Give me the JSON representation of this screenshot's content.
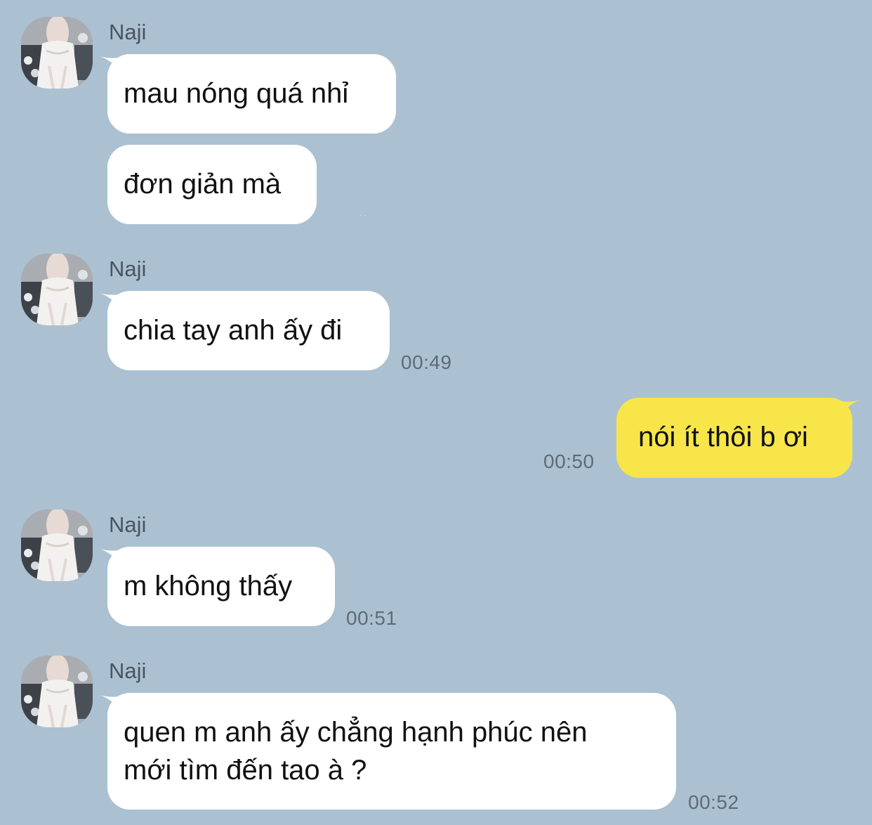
{
  "colors": {
    "background": "#abc1d1",
    "incoming_bubble": "#ffffff",
    "outgoing_bubble": "#f8e54a",
    "timestamp": "#5d6b76"
  },
  "messages": [
    {
      "direction": "incoming",
      "sender": "Naji",
      "avatar_icon": "profile-photo-avatar",
      "bubbles": [
        {
          "lines": [
            "mau nóng quá nhỉ"
          ]
        },
        {
          "lines": [
            "đơn giản mà"
          ]
        }
      ],
      "time": ""
    },
    {
      "direction": "incoming",
      "sender": "Naji",
      "avatar_icon": "profile-photo-avatar",
      "bubbles": [
        {
          "lines": [
            "chia tay anh ấy đi"
          ]
        }
      ],
      "time": "00:49"
    },
    {
      "direction": "outgoing",
      "bubbles": [
        {
          "lines": [
            "nói ít thôi b ơi"
          ]
        }
      ],
      "time": "00:50"
    },
    {
      "direction": "incoming",
      "sender": "Naji",
      "avatar_icon": "profile-photo-avatar",
      "bubbles": [
        {
          "lines": [
            "m không thấy"
          ]
        }
      ],
      "time": "00:51"
    },
    {
      "direction": "incoming",
      "sender": "Naji",
      "avatar_icon": "profile-photo-avatar",
      "bubbles": [
        {
          "lines": [
            "quen m anh ấy chẳng hạnh phúc nên",
            "mới tìm đến tao à ?"
          ]
        }
      ],
      "time": "00:52"
    }
  ]
}
